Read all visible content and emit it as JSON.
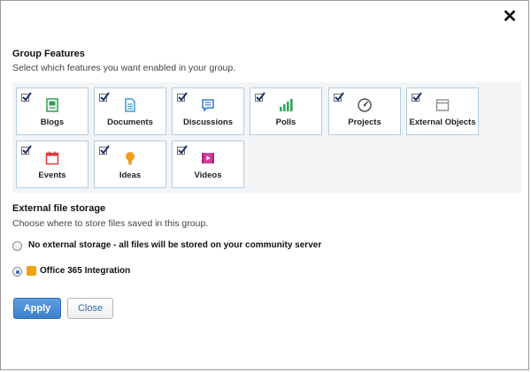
{
  "dialog": {
    "close_glyph": "✕"
  },
  "group_features": {
    "title": "Group Features",
    "subtitle": "Select which features you want enabled in your group.",
    "items": [
      {
        "label": "Blogs",
        "icon": "blog-icon",
        "checked": true,
        "color": "#2e9e4f"
      },
      {
        "label": "Documents",
        "icon": "document-icon",
        "checked": true,
        "color": "#3a9bd8"
      },
      {
        "label": "Discussions",
        "icon": "discussion-icon",
        "checked": true,
        "color": "#2f7fcf"
      },
      {
        "label": "Polls",
        "icon": "poll-icon",
        "checked": true,
        "color": "#2fa55a"
      },
      {
        "label": "Projects",
        "icon": "project-icon",
        "checked": true,
        "color": "#555555"
      },
      {
        "label": "External Objects",
        "icon": "external-object-icon",
        "checked": true,
        "color": "#8a8a8a"
      },
      {
        "label": "Events",
        "icon": "calendar-icon",
        "checked": true,
        "color": "#e03a3a"
      },
      {
        "label": "Ideas",
        "icon": "lightbulb-icon",
        "checked": true,
        "color": "#f39c1b"
      },
      {
        "label": "Videos",
        "icon": "video-icon",
        "checked": true,
        "color": "#d63ea0"
      }
    ]
  },
  "external_storage": {
    "title": "External file storage",
    "subtitle": "Choose where to store files saved in this group.",
    "options": [
      {
        "label": "No external storage - all files will be stored on your community server",
        "selected": false
      },
      {
        "label": "Office 365 Integration",
        "selected": true,
        "icon": "office365-icon"
      }
    ]
  },
  "actions": {
    "apply_label": "Apply",
    "close_label": "Close"
  }
}
